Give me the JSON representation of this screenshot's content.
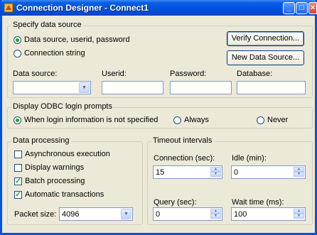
{
  "window": {
    "title": "Connection Designer - Connect1"
  },
  "title_buttons": {
    "minimize": "_",
    "maximize": "□",
    "close": "×"
  },
  "specify": {
    "legend": "Specify data source",
    "radio_dsn": "Data source, userid, password",
    "radio_conn": "Connection string",
    "verify_button": "Verify Connection...",
    "new_ds_button": "New Data Source...",
    "labels": {
      "datasource": "Data source:",
      "userid": "Userid:",
      "password": "Password:",
      "database": "Database:"
    },
    "values": {
      "datasource": "",
      "userid": "",
      "password": "",
      "database": ""
    }
  },
  "odbc": {
    "legend": "Display ODBC login prompts",
    "opt1": "When login information is not specified",
    "opt2": "Always",
    "opt3": "Never"
  },
  "processing": {
    "legend": "Data processing",
    "async": "Asynchronous execution",
    "warnings": "Display warnings",
    "batch": "Batch processing",
    "autotrans": "Automatic transactions",
    "packet_label": "Packet size:",
    "packet_value": "4096"
  },
  "timeout": {
    "legend": "Timeout intervals",
    "connection_label": "Connection (sec):",
    "connection_value": "15",
    "idle_label": "Idle (min):",
    "idle_value": "0",
    "query_label": "Query (sec):",
    "query_value": "0",
    "wait_label": "Wait time (ms):",
    "wait_value": "100"
  }
}
